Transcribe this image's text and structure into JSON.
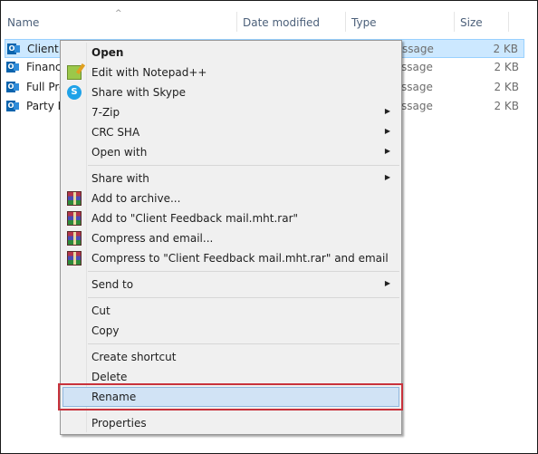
{
  "columns": {
    "name": "Name",
    "date_modified": "Date modified",
    "type": "Type",
    "size": "Size",
    "sort_indicator": "^"
  },
  "files": [
    {
      "name": "Client Feedback mail.mht",
      "name_visible": "Client F",
      "type_visible": "ssage",
      "size": "2 KB",
      "icon": "outlook-message-icon",
      "selected": true
    },
    {
      "name_visible": "Financi",
      "type_visible": "ssage",
      "size": "2 KB",
      "icon": "outlook-message-icon",
      "selected": false
    },
    {
      "name_visible": "Full Pre",
      "type_visible": "ssage",
      "size": "2 KB",
      "icon": "outlook-message-icon",
      "selected": false
    },
    {
      "name_visible": "Party Ir",
      "type_visible": "ssage",
      "size": "2 KB",
      "icon": "outlook-message-icon",
      "selected": false
    }
  ],
  "context_menu": {
    "items": [
      {
        "label": "Open",
        "bold": true
      },
      {
        "label": "Edit with Notepad++",
        "icon": "notepad-plus-plus-icon"
      },
      {
        "label": "Share with Skype",
        "icon": "skype-icon"
      },
      {
        "label": "7-Zip",
        "submenu": true
      },
      {
        "label": "CRC SHA",
        "submenu": true
      },
      {
        "label": "Open with",
        "submenu": true
      },
      {
        "label": "Share with",
        "submenu": true
      },
      {
        "label": "Add to archive...",
        "icon": "winrar-icon"
      },
      {
        "label": "Add to \"Client Feedback mail.mht.rar\"",
        "icon": "winrar-icon"
      },
      {
        "label": "Compress and email...",
        "icon": "winrar-icon"
      },
      {
        "label": "Compress to \"Client Feedback mail.mht.rar\" and email",
        "icon": "winrar-icon"
      },
      {
        "label": "Send to",
        "submenu": true
      },
      {
        "label": "Cut"
      },
      {
        "label": "Copy"
      },
      {
        "label": "Create shortcut"
      },
      {
        "label": "Delete"
      },
      {
        "label": "Rename",
        "highlighted": true
      },
      {
        "label": "Properties"
      }
    ],
    "submenu_arrow": "▶",
    "highlight_color": "#c8323c"
  },
  "icons": {
    "outlook_glyph": "O",
    "skype_glyph": "S"
  }
}
